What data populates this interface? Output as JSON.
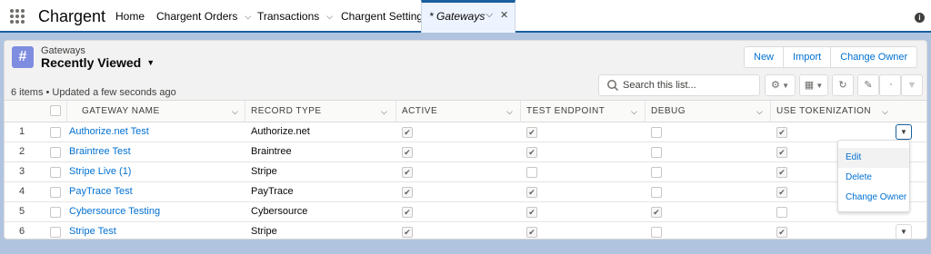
{
  "app": {
    "name": "Chargent"
  },
  "nav": {
    "items": [
      {
        "label": "Home",
        "has_menu": false
      },
      {
        "label": "Chargent Orders",
        "has_menu": true
      },
      {
        "label": "Transactions",
        "has_menu": true
      },
      {
        "label": "Chargent Settings",
        "has_menu": false
      }
    ],
    "active_tab": {
      "label": "* Gateways"
    }
  },
  "header": {
    "object_type": "Gateways",
    "list_view": "Recently Viewed",
    "summary": "6 items • Updated a few seconds ago",
    "buttons": {
      "new": "New",
      "import": "Import",
      "change_owner": "Change Owner"
    },
    "search_placeholder": "Search this list..."
  },
  "table": {
    "columns": [
      "GATEWAY NAME",
      "RECORD TYPE",
      "ACTIVE",
      "TEST ENDPOINT",
      "DEBUG",
      "USE TOKENIZATION"
    ],
    "rows": [
      {
        "num": "1",
        "name": "Authorize.net Test",
        "record_type": "Authorize.net",
        "active": true,
        "test_endpoint": true,
        "debug": false,
        "use_tokenization": true
      },
      {
        "num": "2",
        "name": "Braintree Test",
        "record_type": "Braintree",
        "active": true,
        "test_endpoint": true,
        "debug": false,
        "use_tokenization": true
      },
      {
        "num": "3",
        "name": "Stripe Live (1)",
        "record_type": "Stripe",
        "active": true,
        "test_endpoint": false,
        "debug": false,
        "use_tokenization": true
      },
      {
        "num": "4",
        "name": "PayTrace Test",
        "record_type": "PayTrace",
        "active": true,
        "test_endpoint": true,
        "debug": false,
        "use_tokenization": true
      },
      {
        "num": "5",
        "name": "Cybersource Testing",
        "record_type": "Cybersource",
        "active": true,
        "test_endpoint": true,
        "debug": true,
        "use_tokenization": false
      },
      {
        "num": "6",
        "name": "Stripe Test",
        "record_type": "Stripe",
        "active": true,
        "test_endpoint": true,
        "debug": false,
        "use_tokenization": true
      }
    ]
  },
  "row_menu": {
    "items": [
      {
        "label": "Edit"
      },
      {
        "label": "Delete"
      },
      {
        "label": "Change Owner"
      }
    ]
  },
  "colors": {
    "brand": "#1b5f9e",
    "link": "#0070d2",
    "object_icon": "#7f8de1"
  }
}
